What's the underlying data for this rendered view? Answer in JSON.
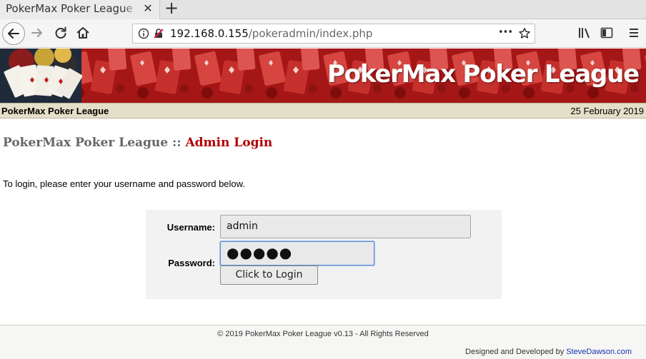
{
  "browser": {
    "tab_title": "PokerMax Poker League :: Ke",
    "tab_close": "✕",
    "new_tab": "+",
    "url_host": "192.168.0.155",
    "url_path": "/pokeradmin/index.php",
    "page_actions": "•••"
  },
  "banner": {
    "title": "PokerMax Poker League"
  },
  "infobar": {
    "site_name": "PokerMax Poker League",
    "date": "25 February 2019"
  },
  "heading": {
    "site": "PokerMax Poker League",
    "separator": " :: ",
    "section": "Admin Login"
  },
  "intro": "To login, please enter your username and password below.",
  "login": {
    "username_label": "Username:",
    "username_value": "admin",
    "password_label": "Password:",
    "password_value": "●●●●●",
    "submit_label": "Click to Login"
  },
  "footer": {
    "copyright": "© 2019 PokerMax Poker League v0.13 - All Rights Reserved",
    "credit_prefix": "Designed and Developed by ",
    "credit_link": "SteveDawson.com"
  },
  "colors": {
    "banner_red": "#b01a1a",
    "heading_accent": "#b00000",
    "infobar_bg": "#e4dfc8",
    "link_blue": "#1a33b0"
  }
}
